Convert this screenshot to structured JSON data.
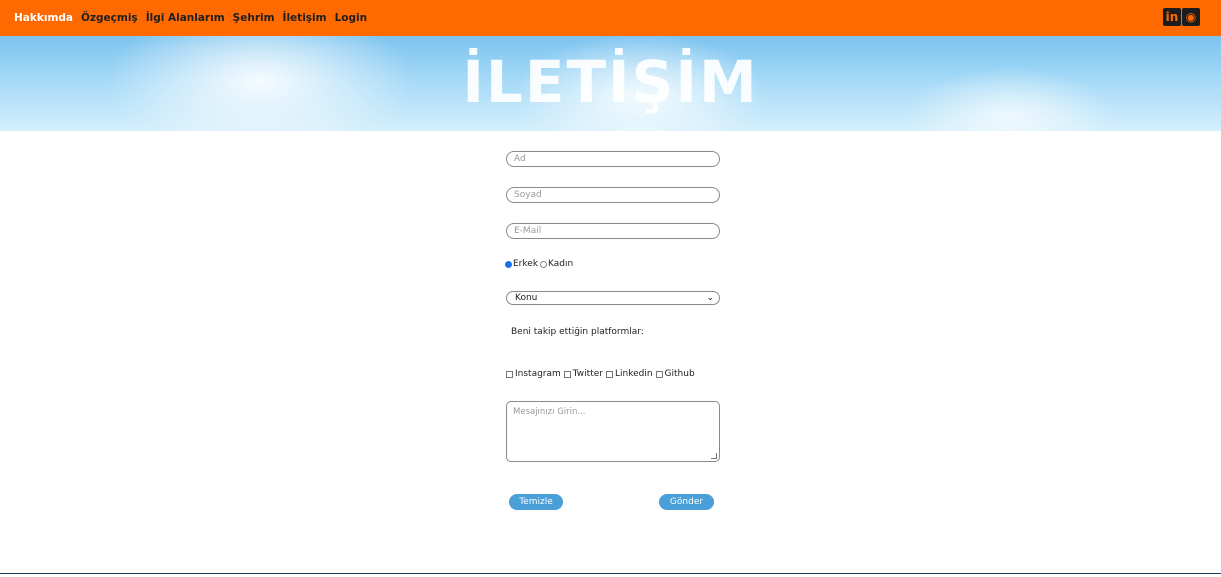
{
  "nav": {
    "links": [
      {
        "label": "Hakkımda"
      },
      {
        "label": "Özgeçmiş"
      },
      {
        "label": "İlgi Alanlarım"
      },
      {
        "label": "Şehrim"
      },
      {
        "label": "İletişim"
      },
      {
        "label": "Login"
      }
    ],
    "social": [
      {
        "icon": "linkedin-icon",
        "glyph": "in"
      },
      {
        "icon": "github-icon",
        "glyph": "◉"
      }
    ]
  },
  "hero": {
    "title": "İLETİŞİM"
  },
  "form": {
    "first_name_placeholder": "Ad",
    "last_name_placeholder": "Soyad",
    "email_placeholder": "E-Mail",
    "gender": {
      "male_label": "Erkek",
      "female_label": "Kadın",
      "selected": "Erkek"
    },
    "subject_selected": "Konu",
    "platforms_label": "Beni takip ettiğin platformlar:",
    "platforms": [
      "Instagram",
      "Twitter",
      "Linkedin",
      "Github"
    ],
    "message_placeholder": "Mesajınızı Girin...",
    "reset_label": "Temizle",
    "submit_label": "Gönder"
  },
  "colors": {
    "navbar": "#ff6a00",
    "button": "#4a9fd8"
  }
}
